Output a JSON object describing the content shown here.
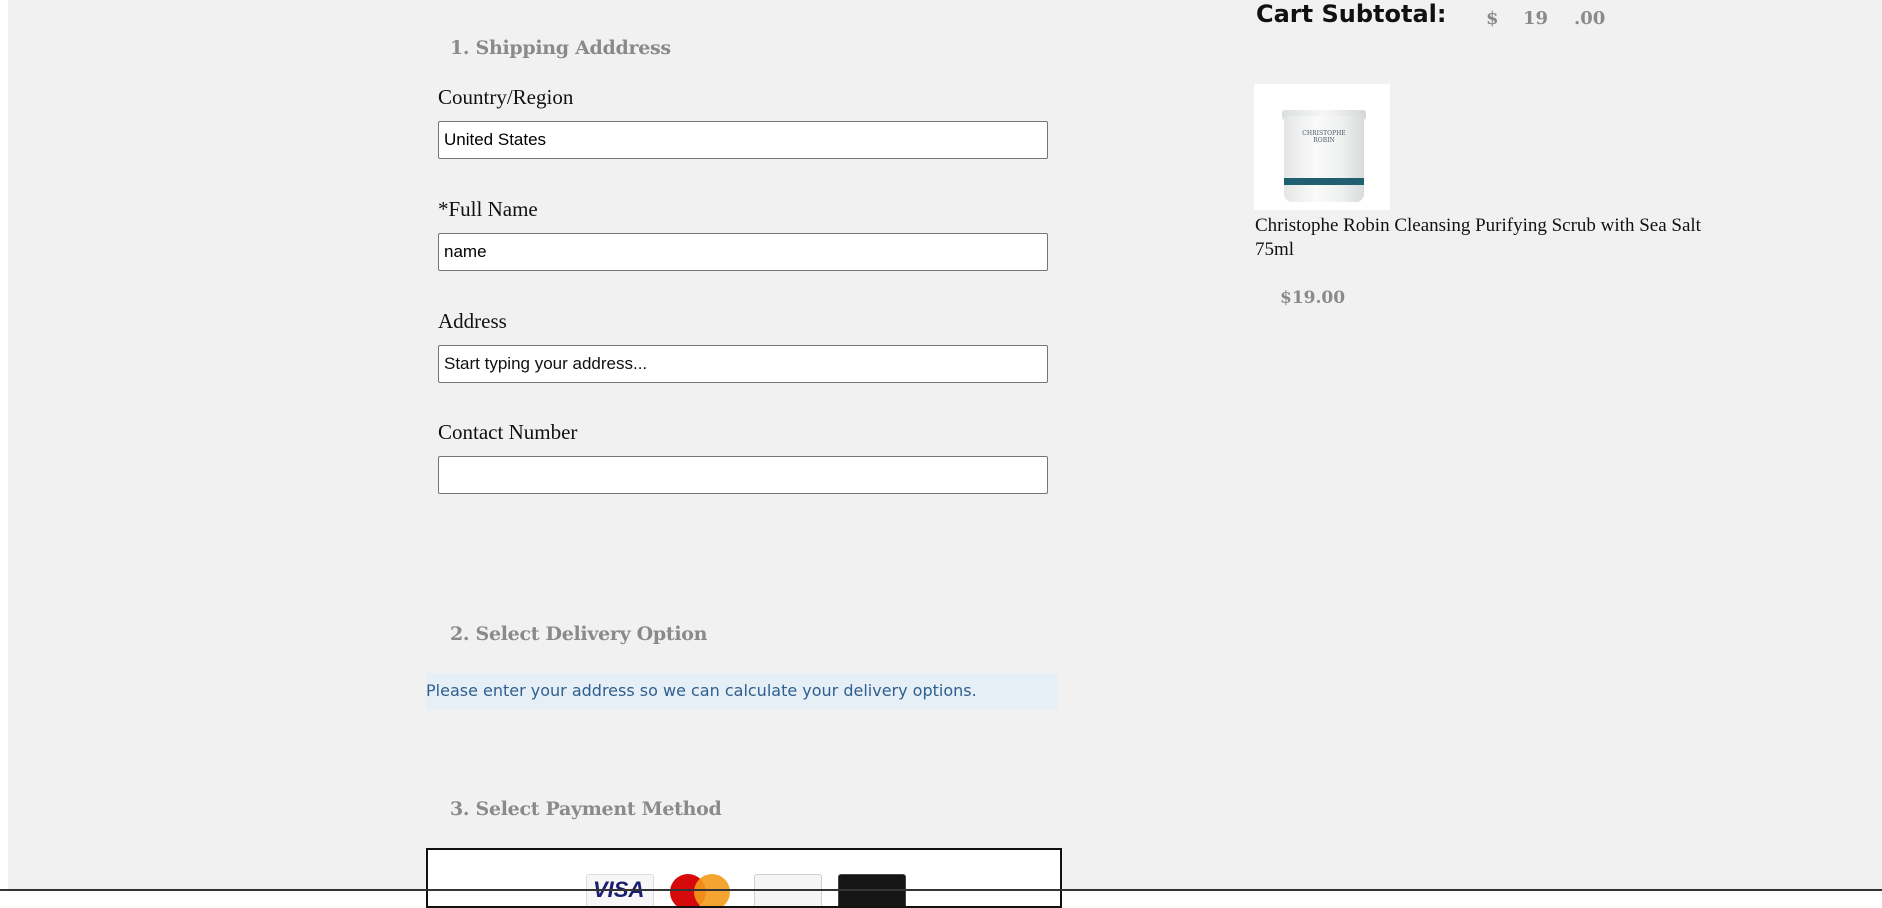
{
  "shipping": {
    "heading": "1. Shipping Adddress",
    "country_label": "Country/Region",
    "country_value": "United States",
    "fullname_label": "*Full Name",
    "fullname_value": "name",
    "address_label": "Address",
    "address_placeholder": "Start typing your address...",
    "contact_label": "Contact Number",
    "contact_value": ""
  },
  "delivery": {
    "heading": "2. Select Delivery Option",
    "note": "Please enter your address so we can calculate your delivery options."
  },
  "payment": {
    "heading": "3. Select Payment Method",
    "cards": [
      {
        "icon": "visa-card-icon",
        "text": "VISA"
      },
      {
        "icon": "mastercard-icon"
      },
      {
        "icon": "amex-card-icon"
      },
      {
        "icon": "black-card-icon"
      }
    ]
  },
  "cart": {
    "subtotal_label": "Cart Subtotal:",
    "currency": "$",
    "amount_whole": "19",
    "amount_cents": ".00",
    "item": {
      "name": "Christophe Robin Cleansing Purifying Scrub with Sea Salt 75ml",
      "price": "$19.00",
      "image_icon": "product-jar-image",
      "brand_on_jar": "CHRISTOPHE ROBIN"
    }
  },
  "colors": {
    "page_background": "#f1f1f1",
    "heading_gray": "#8a8a8a",
    "note_background": "#e6eef6",
    "note_text": "#2f5f8f"
  }
}
